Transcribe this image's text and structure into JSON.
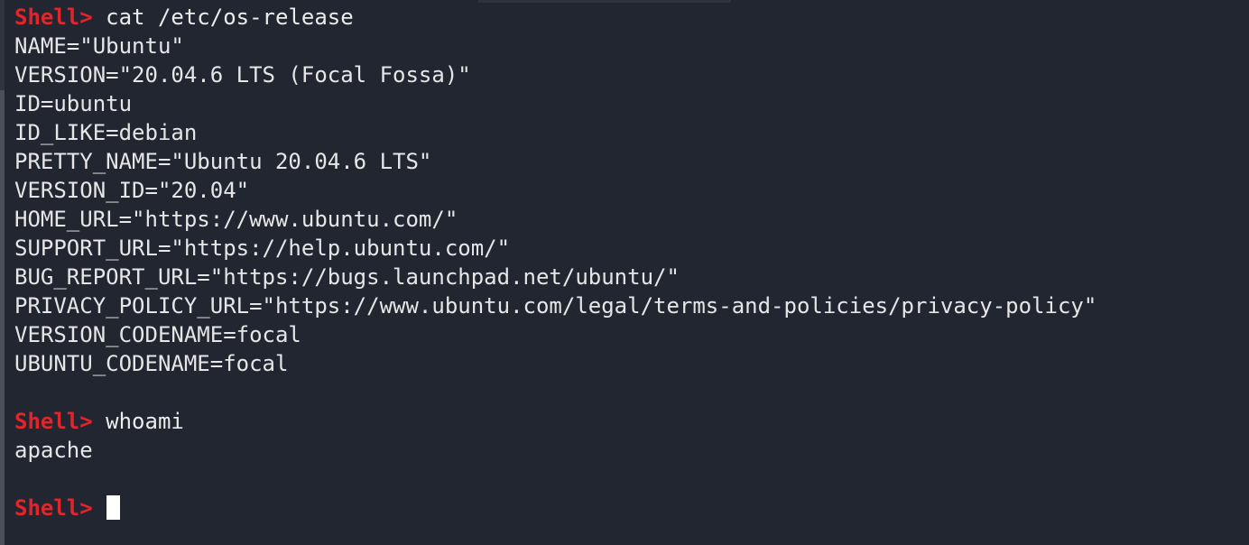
{
  "prompt": "Shell>",
  "session": [
    {
      "command": "cat /etc/os-release",
      "output": [
        "NAME=\"Ubuntu\"",
        "VERSION=\"20.04.6 LTS (Focal Fossa)\"",
        "ID=ubuntu",
        "ID_LIKE=debian",
        "PRETTY_NAME=\"Ubuntu 20.04.6 LTS\"",
        "VERSION_ID=\"20.04\"",
        "HOME_URL=\"https://www.ubuntu.com/\"",
        "SUPPORT_URL=\"https://help.ubuntu.com/\"",
        "BUG_REPORT_URL=\"https://bugs.launchpad.net/ubuntu/\"",
        "PRIVACY_POLICY_URL=\"https://www.ubuntu.com/legal/terms-and-policies/privacy-policy\"",
        "VERSION_CODENAME=focal",
        "UBUNTU_CODENAME=focal",
        ""
      ]
    },
    {
      "command": "whoami",
      "output": [
        "apache",
        ""
      ]
    }
  ],
  "current_input": "",
  "colors": {
    "background": "#222631",
    "prompt": "#e2242b",
    "text": "#e6e6e6",
    "cursor": "#ffffff"
  }
}
